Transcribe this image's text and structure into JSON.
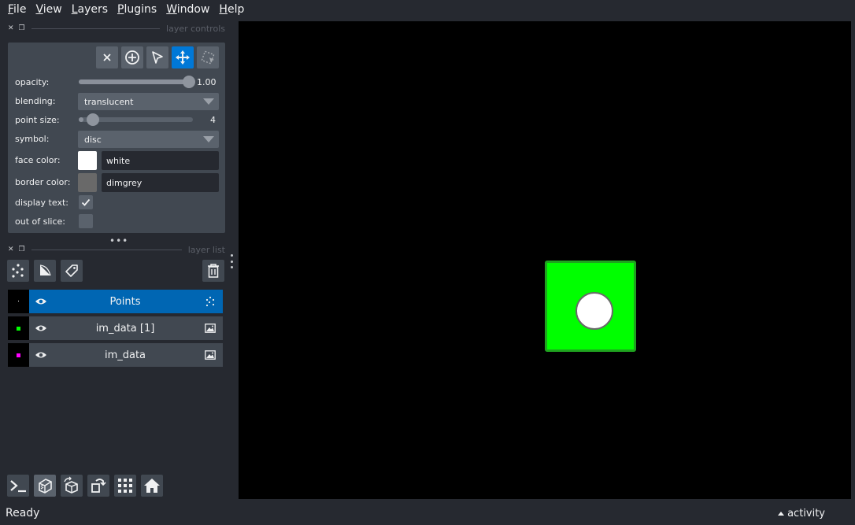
{
  "menu": [
    {
      "accel": "F",
      "rest": "ile"
    },
    {
      "accel": "V",
      "rest": "iew"
    },
    {
      "accel": "L",
      "rest": "ayers"
    },
    {
      "accel": "P",
      "rest": "lugins"
    },
    {
      "accel": "W",
      "rest": "indow"
    },
    {
      "accel": "H",
      "rest": "elp"
    }
  ],
  "dock": {
    "controls_title": "layer controls",
    "list_title": "layer list"
  },
  "controls": {
    "opacity_label": "opacity:",
    "opacity_value": "1.00",
    "opacity_fraction": 1.0,
    "blending_label": "blending:",
    "blending_value": "translucent",
    "point_size_label": "point size:",
    "point_size_value": "4",
    "point_size_fraction": 0.04,
    "symbol_label": "symbol:",
    "symbol_value": "disc",
    "face_color_label": "face color:",
    "face_color_value": "white",
    "face_color_hex": "#ffffff",
    "border_color_label": "border color:",
    "border_color_value": "dimgrey",
    "border_color_hex": "#696969",
    "display_text_label": "display text:",
    "display_text_checked": true,
    "out_of_slice_label": "out of slice:",
    "out_of_slice_checked": false
  },
  "layers": [
    {
      "name": "Points",
      "type": "points-icon",
      "selected": true,
      "thumb_color": "#ffffff"
    },
    {
      "name": "im_data [1]",
      "type": "image-icon",
      "selected": false,
      "thumb_color": "#00ff00"
    },
    {
      "name": "im_data",
      "type": "image-icon",
      "selected": false,
      "thumb_color": "#ff00ff"
    }
  ],
  "status": {
    "text": "Ready",
    "activity": "activity"
  },
  "colors": {
    "accent": "#0078d7",
    "selected_row": "#0066b3",
    "panel": "#414851",
    "background": "#262930"
  }
}
